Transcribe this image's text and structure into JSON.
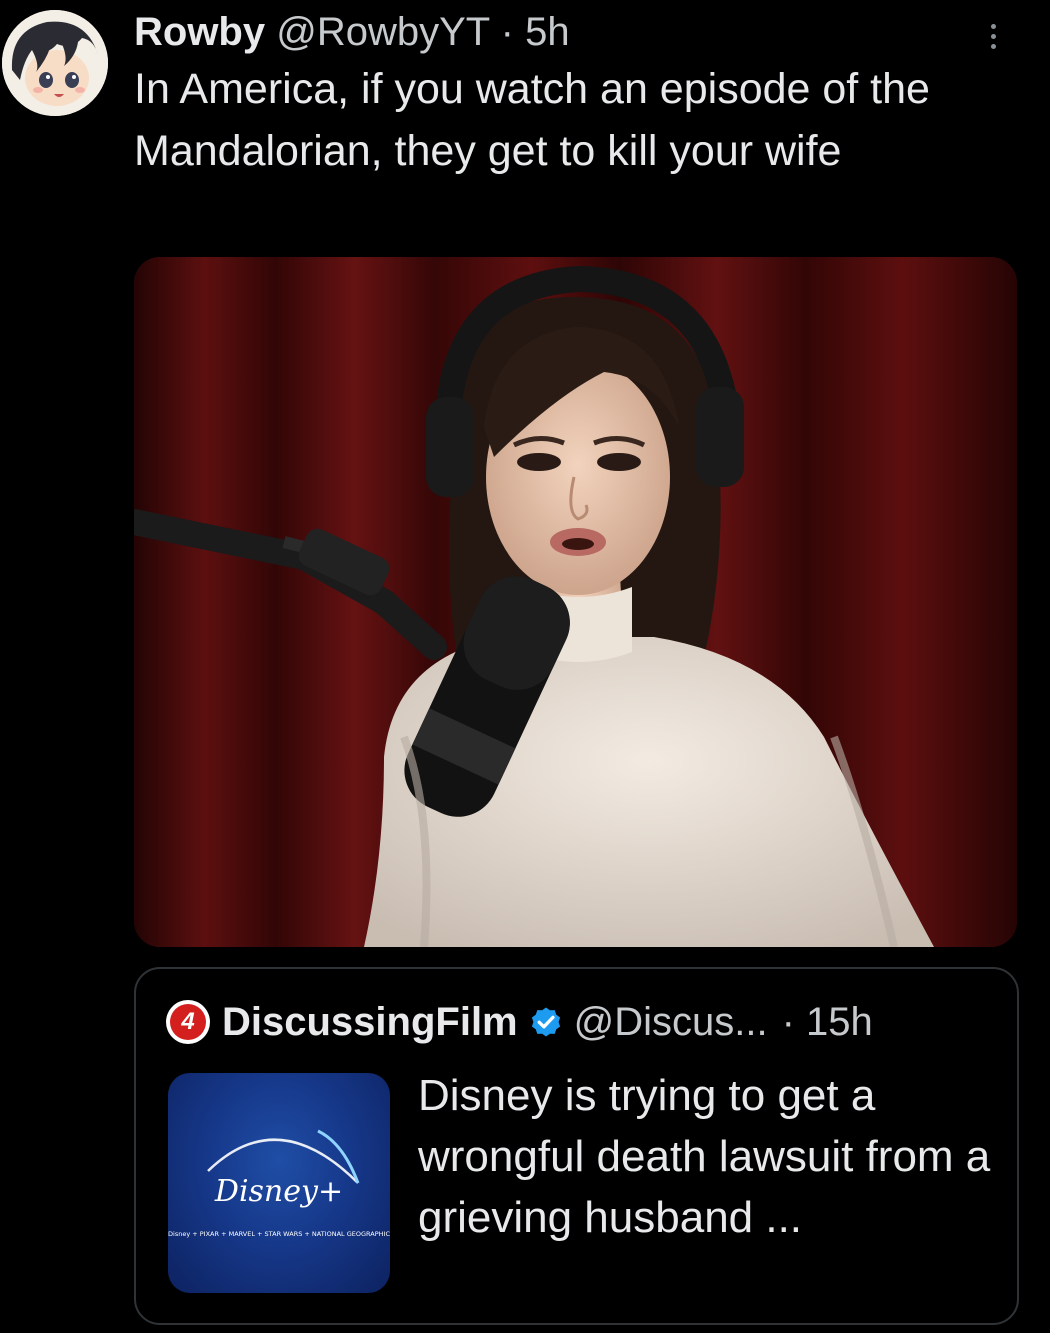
{
  "tweet": {
    "author_name": "Rowby",
    "author_handle": "@RowbyYT",
    "separator": "·",
    "time": "5h",
    "text": "In America, if you watch an episode of the Mandalorian, they get to kill your wife",
    "more_icon": "more-vertical-icon"
  },
  "quoted_tweet": {
    "author_name": "DiscussingFilm",
    "logo_text": "4",
    "verified": true,
    "author_handle": "@Discus...",
    "time": "· 15h",
    "text": "Disney is trying to get a wrongful death lawsuit from a grieving husband ...",
    "thumbnail": {
      "logo_text": "Disney+",
      "brands_text": "Disney + PIXAR + MARVEL + STAR WARS + NATIONAL GEOGRAPHIC"
    }
  },
  "colors": {
    "background": "#000000",
    "text": "#e7e9ea",
    "meta": "#c7cacd",
    "border": "#2f3336",
    "verified": "#1d9bf0",
    "disney_blue": "#16388a"
  }
}
